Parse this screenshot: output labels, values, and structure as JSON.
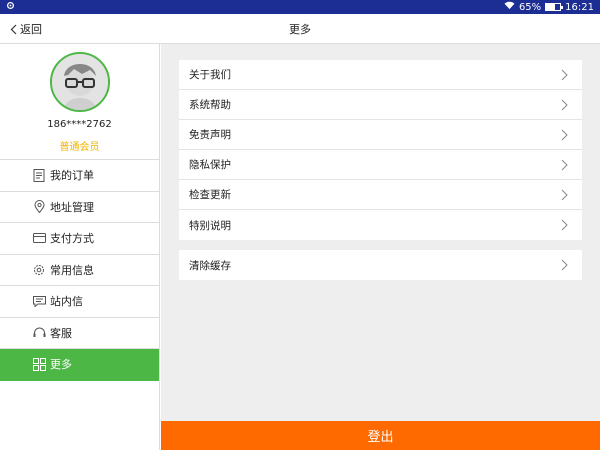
{
  "status_bar": {
    "battery": "65%",
    "battery_level": 0.65,
    "time": "16:21"
  },
  "nav": {
    "back_label": "返回",
    "title": "更多"
  },
  "profile": {
    "phone": "186****2762",
    "member_level": "普通会员"
  },
  "sidebar": {
    "items": [
      {
        "label": "我的订单",
        "icon": "order-list-icon"
      },
      {
        "label": "地址管理",
        "icon": "location-pin-icon"
      },
      {
        "label": "支付方式",
        "icon": "credit-card-icon"
      },
      {
        "label": "常用信息",
        "icon": "gear-icon"
      },
      {
        "label": "站内信",
        "icon": "message-icon"
      },
      {
        "label": "客服",
        "icon": "headset-icon"
      },
      {
        "label": "更多",
        "icon": "grid-icon",
        "active": true
      }
    ]
  },
  "more_list": {
    "group1": [
      "关于我们",
      "系统帮助",
      "免责声明",
      "隐私保护",
      "检查更新",
      "特别说明"
    ],
    "group2": [
      "清除缓存"
    ]
  },
  "logout": {
    "label": "登出"
  },
  "colors": {
    "accent": "#4cb745",
    "logout": "#ff6a00",
    "status_bar": "#1c2e93",
    "member": "#f0b400"
  }
}
